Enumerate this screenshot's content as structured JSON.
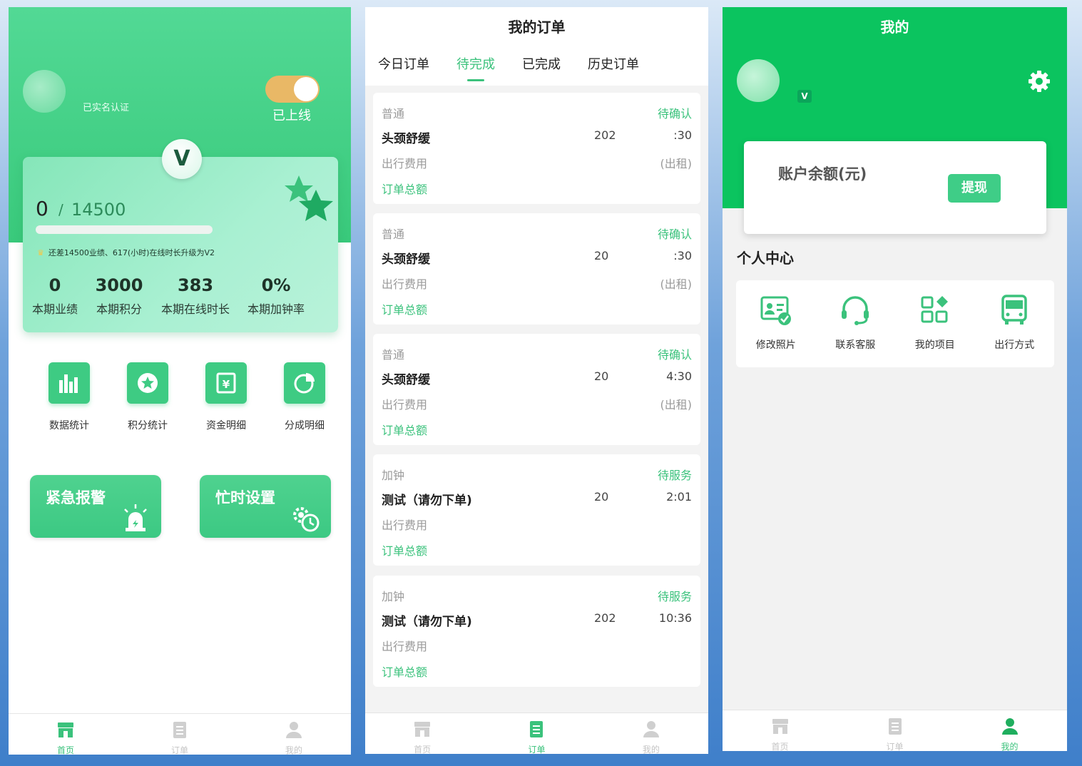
{
  "colors": {
    "primary": "#3bc27c",
    "header_green": "#0bc45f",
    "toggle_on": "#e9b866"
  },
  "home": {
    "verify_text": "已实名认证",
    "online_label": "已上线",
    "online": true,
    "level_badge": "V",
    "progress": {
      "current": "0",
      "separator": "/",
      "target": "14500",
      "fraction": 0.0
    },
    "upgrade_hint": "还差14500业绩、617(小时)在线时长升级为V2",
    "stats": [
      {
        "value": "0",
        "label": "本期业绩"
      },
      {
        "value": "3000",
        "label": "本期积分"
      },
      {
        "value": "383",
        "label": "本期在线时长"
      },
      {
        "value": "0%",
        "label": "本期加钟率"
      }
    ],
    "menu": [
      {
        "label": "数据统计",
        "icon": "bar-chart-icon"
      },
      {
        "label": "积分统计",
        "icon": "star-badge-icon"
      },
      {
        "label": "资金明细",
        "icon": "yuan-receipt-icon"
      },
      {
        "label": "分成明细",
        "icon": "pie-chart-icon"
      }
    ],
    "actions": [
      {
        "label": "紧急报警",
        "icon": "alarm-light-icon"
      },
      {
        "label": "忙时设置",
        "icon": "gear-clock-icon"
      }
    ]
  },
  "orders": {
    "title": "我的订单",
    "tabs": [
      {
        "label": "今日订单",
        "active": false
      },
      {
        "label": "待完成",
        "active": true
      },
      {
        "label": "已完成",
        "active": false
      },
      {
        "label": "历史订单",
        "active": false
      }
    ],
    "list": [
      {
        "type": "普通",
        "status": "待确认",
        "name": "头颈舒缓",
        "date": "202",
        "time": ":30",
        "fee_label": "出行费用",
        "fee_value": "(出租)",
        "total_label": "订单总额"
      },
      {
        "type": "普通",
        "status": "待确认",
        "name": "头颈舒缓",
        "date": "20",
        "time": ":30",
        "fee_label": "出行费用",
        "fee_value": "(出租)",
        "total_label": "订单总额"
      },
      {
        "type": "普通",
        "status": "待确认",
        "name": "头颈舒缓",
        "date": "20",
        "time": "4:30",
        "fee_label": "出行费用",
        "fee_value": "(出租)",
        "total_label": "订单总额"
      },
      {
        "type": "加钟",
        "status": "待服务",
        "name": "测试（请勿下单)",
        "date": "20",
        "time": "2:01",
        "fee_label": "出行费用",
        "fee_value": "",
        "total_label": "订单总额"
      },
      {
        "type": "加钟",
        "status": "待服务",
        "name": "测试（请勿下单)",
        "date": "202",
        "time": "10:36",
        "fee_label": "出行费用",
        "fee_value": "",
        "total_label": "订单总额"
      }
    ]
  },
  "mine": {
    "title": "我的",
    "level_badge": "V",
    "balance_label": "账户余额(元)",
    "withdraw_label": "提现",
    "section_title": "个人中心",
    "items": [
      {
        "label": "修改照片",
        "icon": "id-card-check-icon"
      },
      {
        "label": "联系客服",
        "icon": "headset-icon"
      },
      {
        "label": "我的项目",
        "icon": "grid-apps-icon"
      },
      {
        "label": "出行方式",
        "icon": "bus-icon"
      }
    ]
  },
  "tabbar": [
    {
      "label": "首页",
      "icon": "store-icon"
    },
    {
      "label": "订单",
      "icon": "clipboard-icon"
    },
    {
      "label": "我的",
      "icon": "user-icon"
    }
  ]
}
